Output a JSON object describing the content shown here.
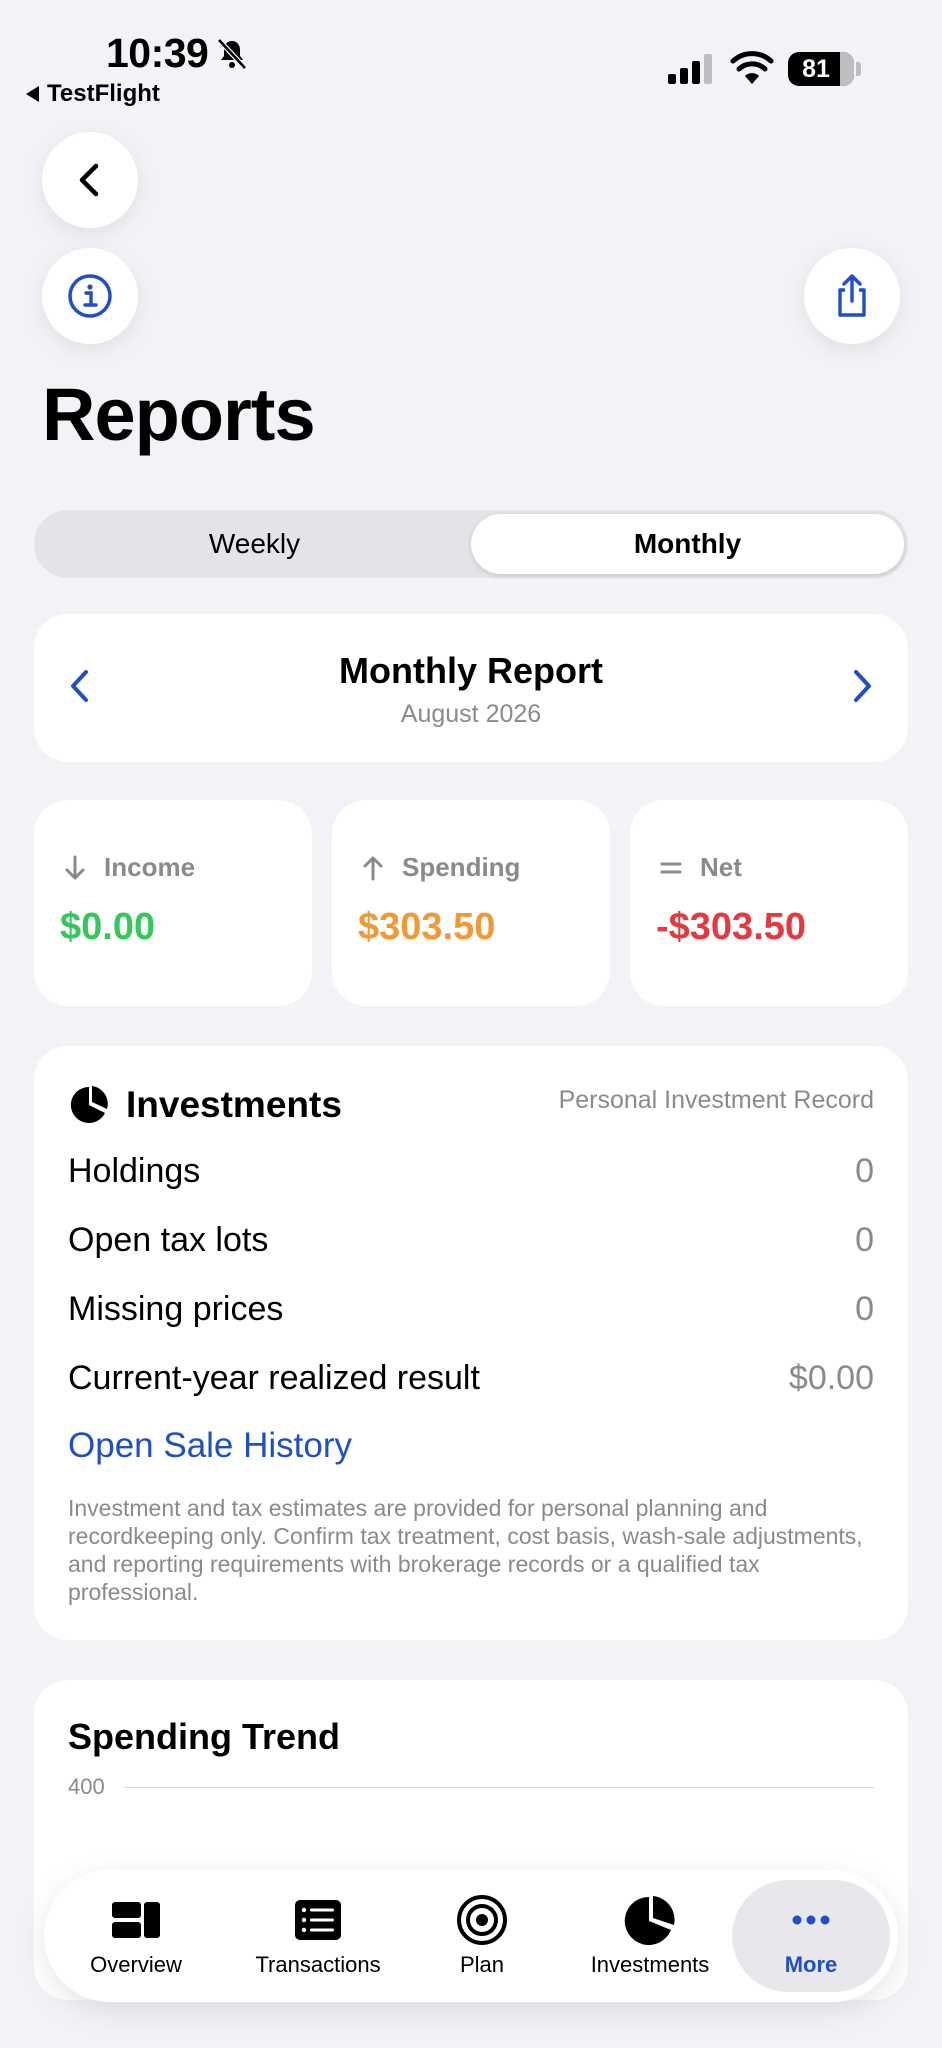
{
  "status": {
    "time": "10:39",
    "back_app": "TestFlight",
    "battery": "81"
  },
  "page": {
    "title": "Reports"
  },
  "segmented": {
    "weekly": "Weekly",
    "monthly": "Monthly",
    "selected": "Monthly"
  },
  "report": {
    "title": "Monthly Report",
    "period": "August 2026"
  },
  "stats": {
    "income": {
      "label": "Income",
      "value": "$0.00",
      "color": "#34c759"
    },
    "spending": {
      "label": "Spending",
      "value": "$303.50",
      "color": "#f09a37"
    },
    "net": {
      "label": "Net",
      "value": "-$303.50",
      "color": "#e5393f"
    }
  },
  "investments": {
    "title": "Investments",
    "record": "Personal Investment Record",
    "rows": [
      {
        "label": "Holdings",
        "value": "0"
      },
      {
        "label": "Open tax lots",
        "value": "0"
      },
      {
        "label": "Missing prices",
        "value": "0"
      },
      {
        "label": "Current-year realized result",
        "value": "$0.00"
      }
    ],
    "link": "Open Sale History",
    "disclaimer": "Investment and tax estimates are provided for personal planning and recordkeeping only. Confirm tax treatment, cost basis, wash-sale adjustments, and reporting requirements with brokerage records or a qualified tax professional."
  },
  "trend": {
    "title": "Spending Trend",
    "axis_top": "400"
  },
  "tabbar": {
    "items": [
      {
        "label": "Overview",
        "icon": "overview-icon"
      },
      {
        "label": "Transactions",
        "icon": "transactions-icon"
      },
      {
        "label": "Plan",
        "icon": "target-icon"
      },
      {
        "label": "Investments",
        "icon": "pie-chart-icon"
      },
      {
        "label": "More",
        "icon": "ellipsis-icon"
      }
    ],
    "active": "More",
    "accent": "#1f4fc4"
  }
}
